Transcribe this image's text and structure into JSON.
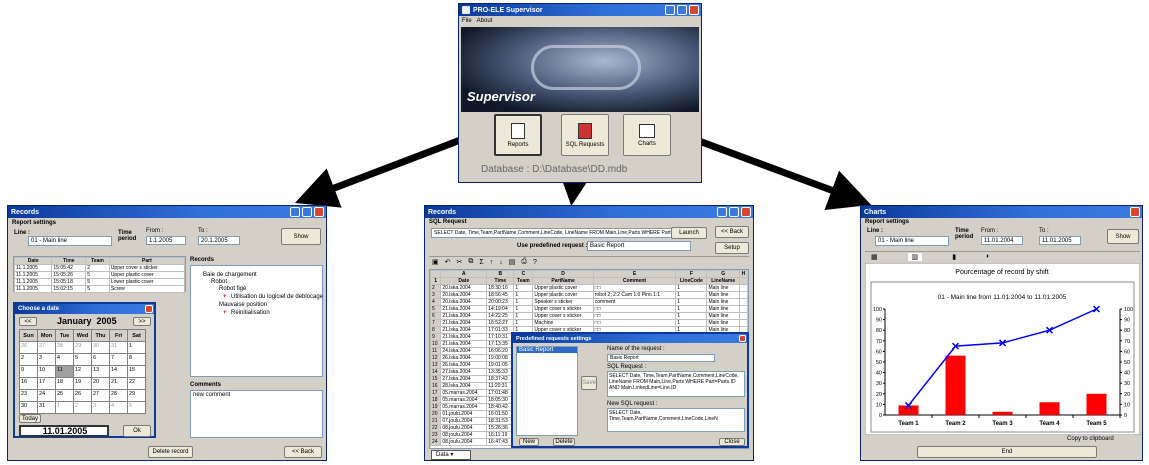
{
  "main": {
    "title": "PRO-ELE Supervisor",
    "menu": [
      "File",
      "About"
    ],
    "banner_text": "Supervisor",
    "buttons": [
      "Reports",
      "SQL Requests",
      "Charts"
    ],
    "database_label": "Database :",
    "database_path": "D:\\Database\\DD.mdb"
  },
  "records": {
    "title": "Records",
    "settings_title": "Report settings",
    "line_label": "Line :",
    "line_value": "01 - Main line",
    "time_label": "Time period",
    "from_label": "From :",
    "from_value": "1.1.2005",
    "to_label": "To :",
    "to_value": "20.1.2005",
    "show_label": "Show",
    "columns": [
      "Date",
      "Time",
      "Team",
      "Part"
    ],
    "rows": [
      [
        "11.1.2005",
        "15:05:42",
        "2",
        "Upper cover s sticker"
      ],
      [
        "11.1.2005",
        "15:05:26",
        "5",
        "Upper plastic cover"
      ],
      [
        "11.1.2005",
        "15:05:18",
        "5",
        "Lower plastic cover"
      ],
      [
        "11.1.2005",
        "15:02:15",
        "5",
        "Screw"
      ]
    ],
    "tree_title": "Records",
    "tree": [
      "Baie de chargement",
      "Robot",
      "Robot figé",
      "Utilisation du logiciel de deblocage",
      "Mauvaise position",
      "Réinitialisation"
    ],
    "comments_title": "Comments",
    "comment_text": "new comment",
    "delete_label": "Delete record",
    "back_label": "<< Back",
    "calendar": {
      "title": "Choose a date",
      "prev": "<<",
      "next": ">>",
      "month": "January",
      "year": "2005",
      "days": [
        "Sun",
        "Mon",
        "Tue",
        "Wed",
        "Thu",
        "Fri",
        "Sat"
      ],
      "weeks": [
        [
          "26",
          "27",
          "28",
          "29",
          "30",
          "31",
          "1"
        ],
        [
          "2",
          "3",
          "4",
          "5",
          "6",
          "7",
          "8"
        ],
        [
          "9",
          "10",
          "11",
          "12",
          "13",
          "14",
          "15"
        ],
        [
          "16",
          "17",
          "18",
          "19",
          "20",
          "21",
          "22"
        ],
        [
          "23",
          "24",
          "25",
          "26",
          "27",
          "28",
          "29"
        ],
        [
          "30",
          "31",
          "1",
          "2",
          "3",
          "4",
          "5"
        ]
      ],
      "today_label": "Today",
      "selected": "11.01.2005",
      "ok_label": "Ok"
    }
  },
  "sql": {
    "title": "Records",
    "request_title": "SQL Request",
    "query": "SELECT Date, Time,Team,PartName,Comment,LineCode, LineName FROM Main,Line,Parts WHERE Part=Parts",
    "launch_label": "Launch",
    "back_label": "<< Back",
    "predefined_label": "Use predefined request :",
    "predefined_value": "Basic Report",
    "setup_label": "Setup",
    "col_letters": [
      "A",
      "B",
      "C",
      "D",
      "E",
      "F",
      "G",
      "H"
    ],
    "columns": [
      "Date",
      "Time",
      "Team",
      "PartName",
      "Comment",
      "LineCode",
      "LineName"
    ],
    "rows": [
      [
        "20.lska.2004",
        "18:30:16",
        "1",
        "Upper plastic cover",
        "□□",
        "1",
        "Main line"
      ],
      [
        "20.lska.2004",
        "18:56:45",
        "1",
        "Upper plastic cover",
        "robot 2; 2:2 Cam 1:0 Pino 1:1",
        "1",
        "Main line"
      ],
      [
        "20.lska.2004",
        "20:00:23",
        "1",
        "Speaker s sticker",
        "comment",
        "1",
        "Main line"
      ],
      [
        "21.lska.2004",
        "14:19:04",
        "1",
        "Upper cover s sticker",
        "□□",
        "1",
        "Main line"
      ],
      [
        "21.lska.2004",
        "14:22:25",
        "1",
        "Upper cover s sticker",
        "□□",
        "1",
        "Main line"
      ],
      [
        "21.lska.2004",
        "16:52:27",
        "1",
        "Machine",
        "□□",
        "1",
        "Main line"
      ],
      [
        "21.lska.2004",
        "17:01:33",
        "1",
        "Upper cover s sticker",
        "□□",
        "1",
        "Main line"
      ],
      [
        "21.lska.2004",
        "17:10:31",
        "",
        "",
        "",
        "",
        ""
      ],
      [
        "21.lska.2004",
        "17:13:35",
        "",
        "",
        "",
        "",
        ""
      ],
      [
        "24.lska.2004",
        "16:06:20",
        "",
        "",
        "",
        "",
        ""
      ],
      [
        "26.lska.2004",
        "19:00:08",
        "",
        "",
        "",
        "",
        ""
      ],
      [
        "26.lska.2004",
        "19:01:05",
        "",
        "",
        "",
        "",
        ""
      ],
      [
        "27.lska.2004",
        "13:35:33",
        "",
        "",
        "",
        "",
        ""
      ],
      [
        "27.lska.2004",
        "18:37:42",
        "",
        "",
        "",
        "",
        ""
      ],
      [
        "28.lska.2004",
        "11:20:31",
        "",
        "",
        "",
        "",
        ""
      ],
      [
        "05.marras.2004",
        "17:01:48",
        "",
        "",
        "",
        "",
        ""
      ],
      [
        "05.marras.2004",
        "18:05:30",
        "",
        "",
        "",
        "",
        ""
      ],
      [
        "05.marras.2004",
        "18:40:42",
        "",
        "",
        "",
        "",
        ""
      ],
      [
        "01.joulu.2004",
        "16:01:50",
        "",
        "",
        "",
        "",
        ""
      ],
      [
        "07.joulu.2004",
        "18:31:53",
        "",
        "",
        "",
        "",
        ""
      ],
      [
        "08.joulu.2004",
        "15:26:36",
        "",
        "",
        "",
        "",
        ""
      ],
      [
        "08.joulu.2004",
        "16:11:19",
        "",
        "",
        "",
        "",
        ""
      ],
      [
        "08.joulu.2004",
        "16:47:43",
        "",
        "",
        "",
        "",
        ""
      ]
    ],
    "sheet_tab": "Data",
    "dialog": {
      "title": "Predefined requests settings",
      "list": [
        "Basic Report"
      ],
      "name_label": "Name of the request :",
      "name_value": "Basic Report",
      "sql_label": "SQL Request :",
      "sql_value": "SELECT Date, Time,Team,PartName,Comment,LineCode, LineName FROM Main,Line,Parts WHERE Part=Parts.ID AND Main.LinkedLine=Line.ID",
      "new_sql_label": "New SQL request :",
      "new_sql_value": "SELECT Date, Time,Team,PartName,Comment,LineCode,LineN",
      "save_label": "Save",
      "new_label": "New",
      "delete_label": "Delete",
      "close_label": "Close"
    }
  },
  "charts": {
    "title": "Charts",
    "settings_title": "Report settings",
    "line_label": "Line :",
    "line_value": "01 - Main line",
    "time_label": "Time period",
    "from_label": "From :",
    "from_value": "11.01.2004",
    "to_label": "To :",
    "to_value": "11.01.2005",
    "show_label": "Show",
    "copy_label": "Copy to clipboard",
    "end_label": "End"
  },
  "chart_data": {
    "type": "bar",
    "title": "Pourcentage of record by shift",
    "subtitle": "01 - Main line   from 11.01.2004 to 11.01.2005",
    "categories": [
      "Team 1",
      "Team 2",
      "Team 3",
      "Team 4",
      "Team 5"
    ],
    "series": [
      {
        "type": "bar",
        "values": [
          9,
          56,
          3,
          12,
          20
        ],
        "color": "#ff0000"
      },
      {
        "type": "line",
        "values": [
          9,
          65,
          68,
          80,
          100
        ],
        "color": "#0000ff"
      }
    ],
    "yticks": [
      "0",
      "10",
      "20",
      "30",
      "40",
      "50",
      "60",
      "70",
      "80",
      "90",
      "100"
    ],
    "ylim": [
      0,
      100
    ],
    "grid": false
  }
}
